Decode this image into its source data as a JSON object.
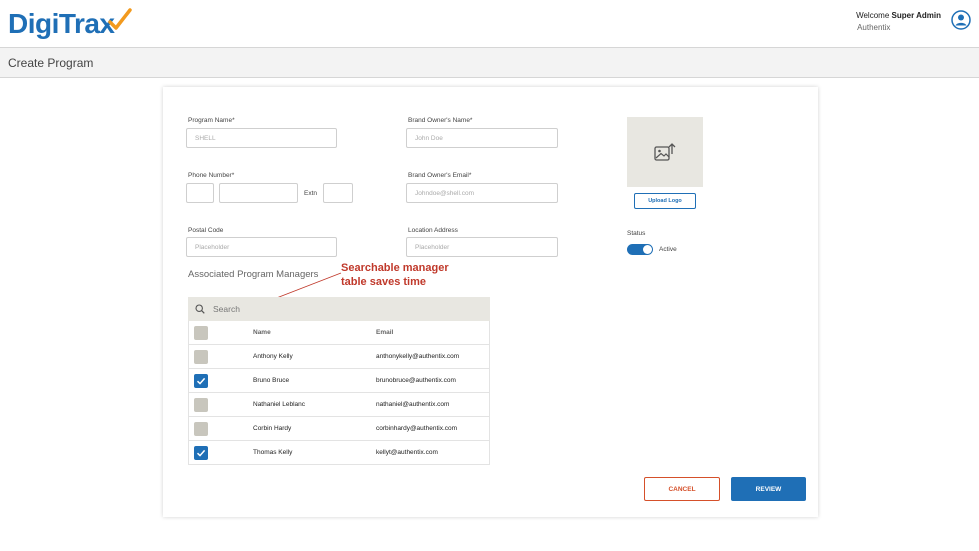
{
  "header": {
    "logo_text": "DigiTrax",
    "welcome_prefix": "Welcome",
    "user_name": "Super Admin",
    "company": "Authentix"
  },
  "page": {
    "title": "Create Program"
  },
  "form": {
    "program_name": {
      "label": "Program Name*",
      "placeholder": "SHELL"
    },
    "brand_owner_name": {
      "label": "Brand Owner's Name*",
      "placeholder": "John Doe"
    },
    "phone_number": {
      "label": "Phone Number*",
      "extn_label": "Extn"
    },
    "brand_owner_email": {
      "label": "Brand Owner's Email*",
      "placeholder": "Johndoe@shell.com"
    },
    "postal_code": {
      "label": "Postal Code",
      "placeholder": "Placeholder"
    },
    "location_address": {
      "label": "Location Address",
      "placeholder": "Placeholder"
    }
  },
  "logo_upload": {
    "button_label": "Upload Logo"
  },
  "status": {
    "label": "Status",
    "value": "Active",
    "enabled": true
  },
  "managers": {
    "section_title": "Associated Program Managers",
    "search_placeholder": "Search",
    "columns": {
      "name": "Name",
      "email": "Email"
    },
    "rows": [
      {
        "name": "Anthony Kelly",
        "email": "anthonykelly@authentix.com",
        "checked": false
      },
      {
        "name": "Bruno Bruce",
        "email": "brunobruce@authentix.com",
        "checked": true
      },
      {
        "name": "Nathaniel Leblanc",
        "email": "nathaniel@authentix.com",
        "checked": false
      },
      {
        "name": "Corbin Hardy",
        "email": "corbinhardy@authentix.com",
        "checked": false
      },
      {
        "name": "Thomas Kelly",
        "email": "kellyt@authentix.com",
        "checked": true
      }
    ]
  },
  "annotation": {
    "line1": "Searchable manager",
    "line2": "table saves time"
  },
  "actions": {
    "cancel_label": "CANCEL",
    "review_label": "REVIEW"
  },
  "colors": {
    "brand_blue": "#1f6fb6",
    "logo_orange": "#f29a1e",
    "cancel_red": "#d5502a",
    "annotation_red": "#c0392b"
  },
  "icons": {
    "logo_placeholder": "image-upload-icon",
    "search": "search-icon",
    "user": "user-avatar-icon"
  }
}
